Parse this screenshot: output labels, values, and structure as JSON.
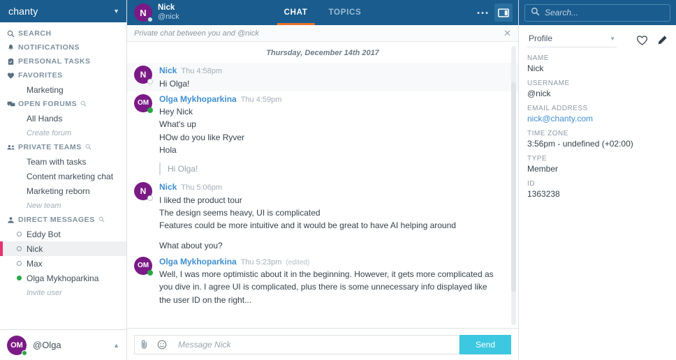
{
  "sidebar": {
    "workspace": "chanty",
    "workspace_caret_icon": "chevron-down-icon",
    "nav": [
      {
        "label": "SEARCH",
        "icon": "search-icon"
      },
      {
        "label": "NOTIFICATIONS",
        "icon": "bell-icon"
      },
      {
        "label": "PERSONAL TASKS",
        "icon": "clipboard-icon"
      },
      {
        "label": "FAVORITES",
        "icon": "heart-icon"
      }
    ],
    "favorites_children": [
      {
        "label": "Marketing"
      }
    ],
    "open_forums": {
      "label": "OPEN FORUMS",
      "icon": "forums-icon",
      "search_icon": "search-icon"
    },
    "open_forums_children": [
      {
        "label": "All Hands",
        "italic": false
      },
      {
        "label": "Create forum",
        "italic": true
      }
    ],
    "private_teams": {
      "label": "PRIVATE TEAMS",
      "icon": "team-icon",
      "search_icon": "search-icon"
    },
    "private_teams_children": [
      {
        "label": "Team with tasks",
        "italic": false
      },
      {
        "label": "Content marketing chat",
        "italic": false
      },
      {
        "label": "Marketing reborn",
        "italic": false
      },
      {
        "label": "New team",
        "italic": true
      }
    ],
    "direct_messages": {
      "label": "DIRECT MESSAGES",
      "icon": "user-icon",
      "search_icon": "search-icon"
    },
    "dms": [
      {
        "label": "Eddy Bot",
        "status": "offline",
        "selected": false
      },
      {
        "label": "Nick",
        "status": "offline",
        "selected": true
      },
      {
        "label": "Max",
        "status": "offline",
        "selected": false
      },
      {
        "label": "Olga Mykhoparkina",
        "status": "online",
        "selected": false
      }
    ],
    "invite": {
      "label": "Invite user",
      "italic": true
    },
    "footer": {
      "initials": "OM",
      "name": "@Olga",
      "caret_icon": "chevron-up-icon",
      "status": "online"
    }
  },
  "center": {
    "header": {
      "avatar_initial": "N",
      "name": "Nick",
      "username": "@nick",
      "tabs": [
        {
          "label": "CHAT",
          "active": true
        },
        {
          "label": "TOPICS",
          "active": false
        }
      ],
      "more_icon": "ellipsis-icon",
      "panel_icon": "panel-toggle-icon"
    },
    "banner": {
      "text": "Private chat between you and @nick",
      "close_icon": "close-icon"
    },
    "day_separator": "Thursday, December 14th 2017",
    "messages": [
      {
        "initials": "N",
        "avatar_size": "lg",
        "status": "offline",
        "author": "Nick",
        "time": "Thu 4:58pm",
        "edited": "",
        "highlighted": true,
        "lines": [
          {
            "text": "Hi Olga!",
            "gap": false
          }
        ],
        "quote": ""
      },
      {
        "initials": "OM",
        "avatar_size": "sm",
        "status": "online",
        "author": "Olga Mykhoparkina",
        "time": "Thu 4:59pm",
        "edited": "",
        "highlighted": false,
        "lines": [
          {
            "text": "Hey Nick",
            "gap": false
          },
          {
            "text": "What's up",
            "gap": false
          },
          {
            "text": "HOw do you like Ryver",
            "gap": false
          },
          {
            "text": "Hola",
            "gap": false
          }
        ],
        "quote": "Hi Olga!"
      },
      {
        "initials": "N",
        "avatar_size": "lg",
        "status": "offline",
        "author": "Nick",
        "time": "Thu 5:06pm",
        "edited": "",
        "highlighted": false,
        "lines": [
          {
            "text": "I liked the product tour",
            "gap": false
          },
          {
            "text": "The design seems heavy, UI is complicated",
            "gap": false
          },
          {
            "text": "Features could be more intuitive and it would be great to have AI helping around",
            "gap": false
          },
          {
            "text": "What about you?",
            "gap": true
          }
        ],
        "quote": ""
      },
      {
        "initials": "OM",
        "avatar_size": "sm",
        "status": "online",
        "author": "Olga Mykhoparkina",
        "time": "Thu 5:23pm",
        "edited": "(edited)",
        "highlighted": false,
        "lines": [
          {
            "text": "Well, I was more optimistic about it in the beginning. However, it gets more complicated as you dive in. I agree UI is complicated, plus there is some unnecessary info displayed like the user ID on the right...",
            "gap": false
          }
        ],
        "quote": ""
      }
    ],
    "composer": {
      "attach_icon": "paperclip-icon",
      "emoji_icon": "emoji-icon",
      "placeholder": "Message Nick",
      "value": "",
      "send_label": "Send"
    }
  },
  "right": {
    "search": {
      "placeholder": "Search...",
      "icon": "search-icon",
      "value": ""
    },
    "selector": {
      "label": "Profile",
      "caret_icon": "chevron-down-icon"
    },
    "favorite_icon": "heart-outline-icon",
    "edit_icon": "pencil-icon",
    "fields": [
      {
        "key": "NAME",
        "value": "Nick",
        "link": false
      },
      {
        "key": "USERNAME",
        "value": "@nick",
        "link": false
      },
      {
        "key": "EMAIL ADDRESS",
        "value": "nick@chanty.com",
        "link": true
      },
      {
        "key": "TIME ZONE",
        "value": "3:56pm - undefined (+02:00)",
        "link": false
      },
      {
        "key": "TYPE",
        "value": "Member",
        "link": false
      },
      {
        "key": "ID",
        "value": "1363238",
        "link": false
      }
    ]
  },
  "colors": {
    "header_blue": "#1a5c8e",
    "accent_orange": "#e8732c",
    "selected_pink": "#e8336d",
    "send_cyan": "#3cc8e0",
    "avatar_purple": "#7b1a86",
    "link_blue": "#3f8fd0",
    "online_green": "#27a844"
  }
}
